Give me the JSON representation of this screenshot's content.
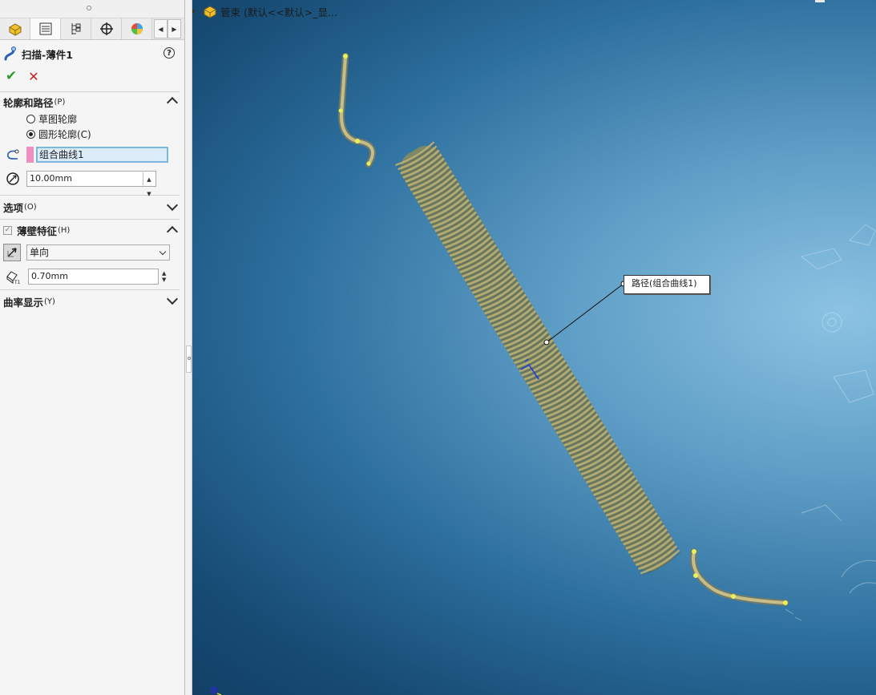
{
  "panel": {
    "tabs": [
      {
        "name": "featuremanager-tab",
        "icon": "featuremanager-icon"
      },
      {
        "name": "propertymanager-tab",
        "icon": "propertymanager-icon"
      },
      {
        "name": "configurationmanager-tab",
        "icon": "configurationmanager-icon"
      },
      {
        "name": "dimxpert-tab",
        "icon": "dimxpert-icon"
      },
      {
        "name": "display-manager-tab",
        "icon": "appearance-icon"
      }
    ],
    "feature_title": "扫描-薄件1",
    "profile_path": {
      "header_label": "轮廓和路径",
      "header_key": "(P)",
      "option_sketch": "草图轮廓",
      "option_circle": "圆形轮廓(C)",
      "selected_option": "圆形轮廓(C)",
      "path_value": "组合曲线1",
      "diameter_value": "10.00mm"
    },
    "options": {
      "header_label": "选项",
      "header_key": "(O)"
    },
    "thin_feature": {
      "header_label": "薄壁特征",
      "header_key": "(H)",
      "checked": true,
      "direction_value": "单向",
      "thickness_value": "0.70mm"
    },
    "curvature": {
      "header_label": "曲率显示",
      "header_key": "(Y)"
    }
  },
  "viewport": {
    "tree_label": "管束  (默认<<默认>_显...",
    "callout_label": "路径(组合曲线1)",
    "colors": {
      "coil": "#b9ae72",
      "highlight": "#e8f05a",
      "callout_border": "#333333"
    }
  }
}
